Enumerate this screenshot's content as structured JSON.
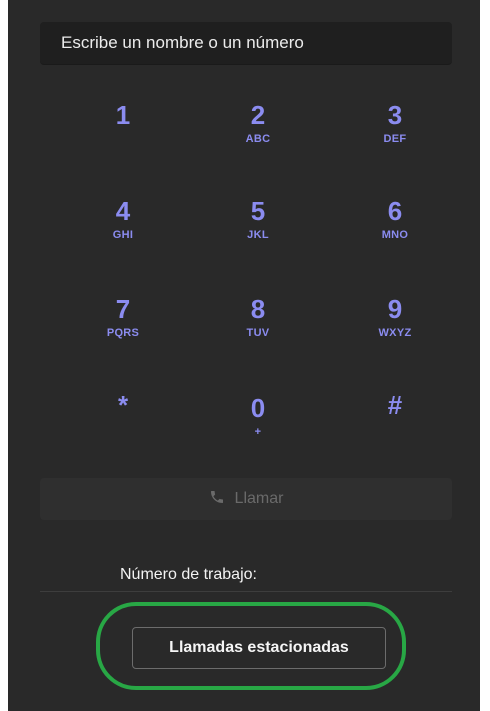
{
  "search": {
    "placeholder": "Escribe un nombre o un número"
  },
  "keypad": {
    "keys": [
      {
        "digit": "1",
        "letters": ""
      },
      {
        "digit": "2",
        "letters": "ABC"
      },
      {
        "digit": "3",
        "letters": "DEF"
      },
      {
        "digit": "4",
        "letters": "GHI"
      },
      {
        "digit": "5",
        "letters": "JKL"
      },
      {
        "digit": "6",
        "letters": "MNO"
      },
      {
        "digit": "7",
        "letters": "PQRS"
      },
      {
        "digit": "8",
        "letters": "TUV"
      },
      {
        "digit": "9",
        "letters": "WXYZ"
      },
      {
        "digit": "*",
        "letters": ""
      },
      {
        "digit": "0",
        "letters": "+"
      },
      {
        "digit": "#",
        "letters": ""
      }
    ]
  },
  "call": {
    "label": "Llamar",
    "icon": "phone-icon"
  },
  "work_number": {
    "label": "Número de trabajo:"
  },
  "parked_calls": {
    "label": "Llamadas estacionadas"
  },
  "colors": {
    "accent": "#8b8cf0",
    "highlight": "#28a745"
  }
}
